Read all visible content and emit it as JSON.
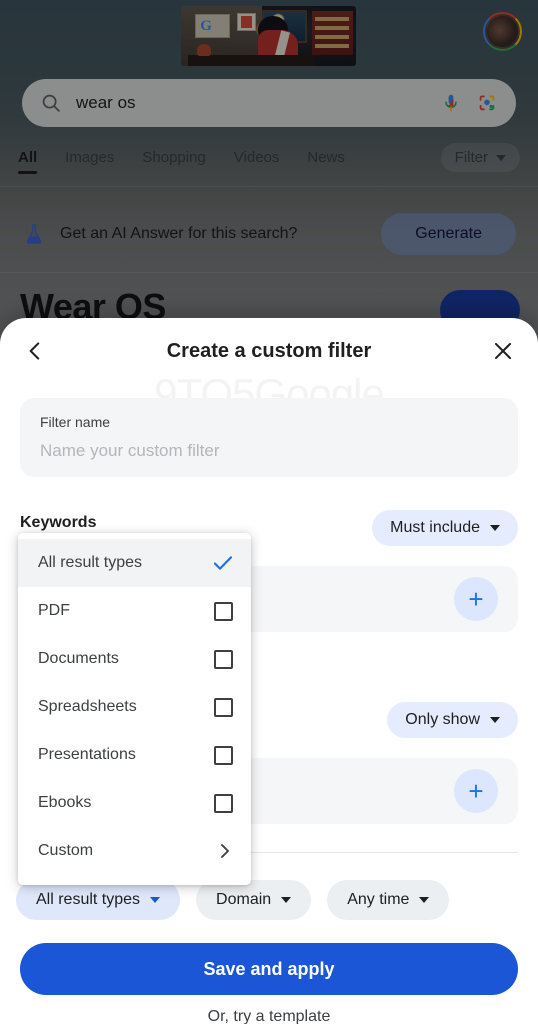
{
  "background": {
    "doodle_name": "google-doodle-illustration",
    "avatar_name": "account-avatar",
    "search": {
      "query": "wear os",
      "search_icon": "search-icon",
      "mic_icon": "microphone-icon",
      "lens_icon": "google-lens-icon"
    },
    "tabs": [
      {
        "label": "All",
        "active": true
      },
      {
        "label": "Images",
        "active": false
      },
      {
        "label": "Shopping",
        "active": false
      },
      {
        "label": "Videos",
        "active": false
      },
      {
        "label": "News",
        "active": false
      }
    ],
    "filter_chip": "Filter",
    "ai_row": {
      "icon": "flask-icon",
      "label": "Get an AI Answer for this search?",
      "button": "Generate"
    },
    "result_title": "Wear OS"
  },
  "sheet": {
    "watermark": "9TO5Google",
    "back_icon": "chevron-left-icon",
    "title": "Create a custom filter",
    "close_icon": "close-icon",
    "filter_name": {
      "label": "Filter name",
      "placeholder": "Name your custom filter",
      "value": ""
    },
    "sections": [
      {
        "label": "Keywords",
        "chip": "Must include",
        "add_icon": "plus-icon"
      },
      {
        "label": "",
        "chip": "Only show",
        "add_icon": "plus-icon"
      }
    ],
    "bottom_chips": [
      {
        "label": "All result types",
        "style": "blue"
      },
      {
        "label": "Domain",
        "style": "grey"
      },
      {
        "label": "Any time",
        "style": "grey"
      }
    ],
    "save_button": "Save and apply",
    "template_link": "Or, try a template"
  },
  "dropdown": {
    "items": [
      {
        "label": "All result types",
        "control": "check",
        "selected": true
      },
      {
        "label": "PDF",
        "control": "checkbox",
        "selected": false
      },
      {
        "label": "Documents",
        "control": "checkbox",
        "selected": false
      },
      {
        "label": "Spreadsheets",
        "control": "checkbox",
        "selected": false
      },
      {
        "label": "Presentations",
        "control": "checkbox",
        "selected": false
      },
      {
        "label": "Ebooks",
        "control": "checkbox",
        "selected": false
      },
      {
        "label": "Custom",
        "control": "chevron",
        "selected": false
      }
    ]
  },
  "colors": {
    "accent_blue": "#1a56d6",
    "chip_blue": "#e4ecfd",
    "check_blue": "#1a73e8",
    "field_grey": "#f4f5f7",
    "text_primary": "#1f1f1f"
  }
}
